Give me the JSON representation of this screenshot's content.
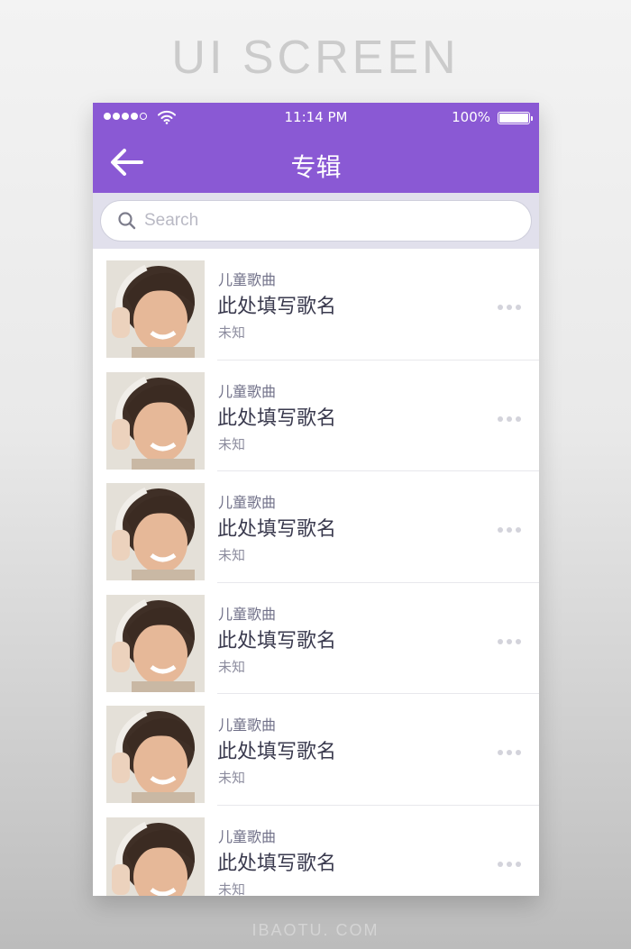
{
  "poster": {
    "title": "UI SCREEN",
    "footer": "IBAOTU. COM"
  },
  "status_bar": {
    "signal_bars_filled": 4,
    "signal_bars_total": 5,
    "time": "11:14 PM",
    "battery_percent_label": "100%",
    "battery_level": 1.0
  },
  "nav": {
    "back_icon": "arrow-left-icon",
    "title": "专辑"
  },
  "search": {
    "icon": "search-icon",
    "placeholder": "Search",
    "value": ""
  },
  "colors": {
    "accent": "#8a59d4",
    "search_bg": "#e1e0ec",
    "text_primary": "#3a3a4e",
    "text_secondary": "#8c8c9e"
  },
  "songs": [
    {
      "category": "儿童歌曲",
      "title": "此处填写歌名",
      "artist": "未知",
      "more_icon": "more-dots-icon"
    },
    {
      "category": "儿童歌曲",
      "title": "此处填写歌名",
      "artist": "未知",
      "more_icon": "more-dots-icon"
    },
    {
      "category": "儿童歌曲",
      "title": "此处填写歌名",
      "artist": "未知",
      "more_icon": "more-dots-icon"
    },
    {
      "category": "儿童歌曲",
      "title": "此处填写歌名",
      "artist": "未知",
      "more_icon": "more-dots-icon"
    },
    {
      "category": "儿童歌曲",
      "title": "此处填写歌名",
      "artist": "未知",
      "more_icon": "more-dots-icon"
    },
    {
      "category": "儿童歌曲",
      "title": "此处填写歌名",
      "artist": "未知",
      "more_icon": "more-dots-icon"
    }
  ]
}
